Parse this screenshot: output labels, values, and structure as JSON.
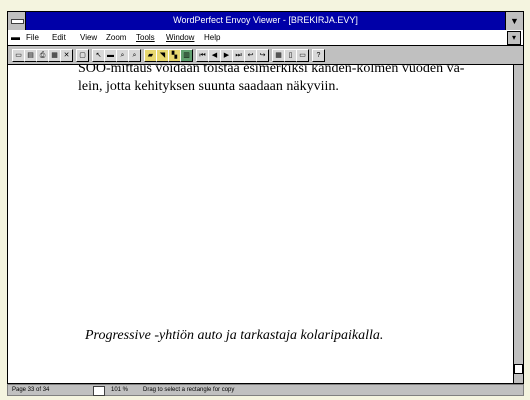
{
  "window": {
    "title": "WordPerfect Envoy Viewer - [BREKIRJA.EVY]"
  },
  "menu": {
    "items": [
      "File",
      "Edit",
      "View",
      "Zoom",
      "Tools",
      "Window",
      "Help"
    ]
  },
  "toolbar": {
    "buttons": [
      {
        "icon": "open-icon",
        "glyph": "▭"
      },
      {
        "icon": "save-icon",
        "glyph": "▤"
      },
      {
        "icon": "print-icon",
        "glyph": "⎙"
      },
      {
        "icon": "find-icon",
        "glyph": "▦"
      },
      {
        "icon": "close-doc-icon",
        "glyph": "✕"
      },
      {
        "icon": "copy-icon",
        "glyph": "▢"
      },
      {
        "icon": "select-arrow-icon",
        "glyph": "↖"
      },
      {
        "icon": "select-text-icon",
        "glyph": "▬"
      },
      {
        "icon": "zoom-in-icon",
        "glyph": "⌕"
      },
      {
        "icon": "zoom-out-icon",
        "glyph": "⌕"
      },
      {
        "icon": "highlight-icon",
        "glyph": "▰"
      },
      {
        "icon": "note-icon",
        "glyph": "◥"
      },
      {
        "icon": "bookmark-icon",
        "glyph": "▚"
      },
      {
        "icon": "hypertext-icon",
        "glyph": "▥"
      },
      {
        "icon": "first-page-icon",
        "glyph": "⏮"
      },
      {
        "icon": "previous-page-icon",
        "glyph": "◀"
      },
      {
        "icon": "next-page-icon",
        "glyph": "▶"
      },
      {
        "icon": "last-page-icon",
        "glyph": "⏭"
      },
      {
        "icon": "go-back-icon",
        "glyph": "↩"
      },
      {
        "icon": "go-forward-icon",
        "glyph": "↪"
      },
      {
        "icon": "thumbnails-icon",
        "glyph": "▦"
      },
      {
        "icon": "fit-page-icon",
        "glyph": "▯"
      },
      {
        "icon": "fit-width-icon",
        "glyph": "▭"
      },
      {
        "icon": "help-icon",
        "glyph": "?"
      }
    ]
  },
  "document": {
    "line1": "SOO-mittaus voidaan toistaa esimerkiksi kanden-kolmen vuoden vä-",
    "line2": "lein, jotta kehityksen suunta saadaan näkyviin.",
    "caption": "Progressive -yhtiön auto ja tarkastaja kolaripaikalla."
  },
  "status": {
    "page": "Page 33 of 34",
    "zoom": "101 %",
    "hint": "Drag to select a rectangle for copy"
  }
}
